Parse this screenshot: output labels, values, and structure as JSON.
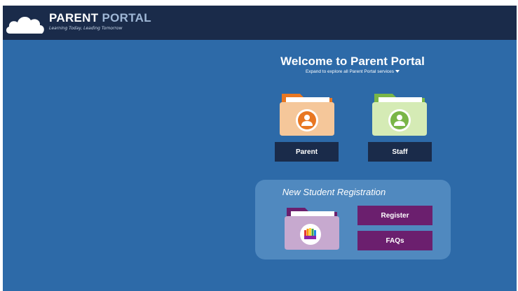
{
  "header": {
    "brand_primary": "PARENT",
    "brand_secondary": "PORTAL",
    "tagline": "Learning Today, Leading Tomorrow"
  },
  "welcome": {
    "title": "Welcome to Parent Portal",
    "subtitle": "Expand to explore all Parent Portal services"
  },
  "roles": [
    {
      "label": "Parent",
      "icon": "parent-user-icon",
      "folder_color": "#f0b98a",
      "badge_color": "#e87722"
    },
    {
      "label": "Staff",
      "icon": "staff-user-icon",
      "folder_color": "#c9e2a6",
      "badge_color": "#7ab648"
    }
  ],
  "registration": {
    "title": "New Student Registration",
    "register_label": "Register",
    "faqs_label": "FAQs",
    "icon": "crayons-icon"
  },
  "colors": {
    "background": "#2d6aa8",
    "header": "#1a2b4a",
    "button_dark": "#1a2b4a",
    "button_purple": "#6b1f6e",
    "panel": "#5089bf"
  }
}
